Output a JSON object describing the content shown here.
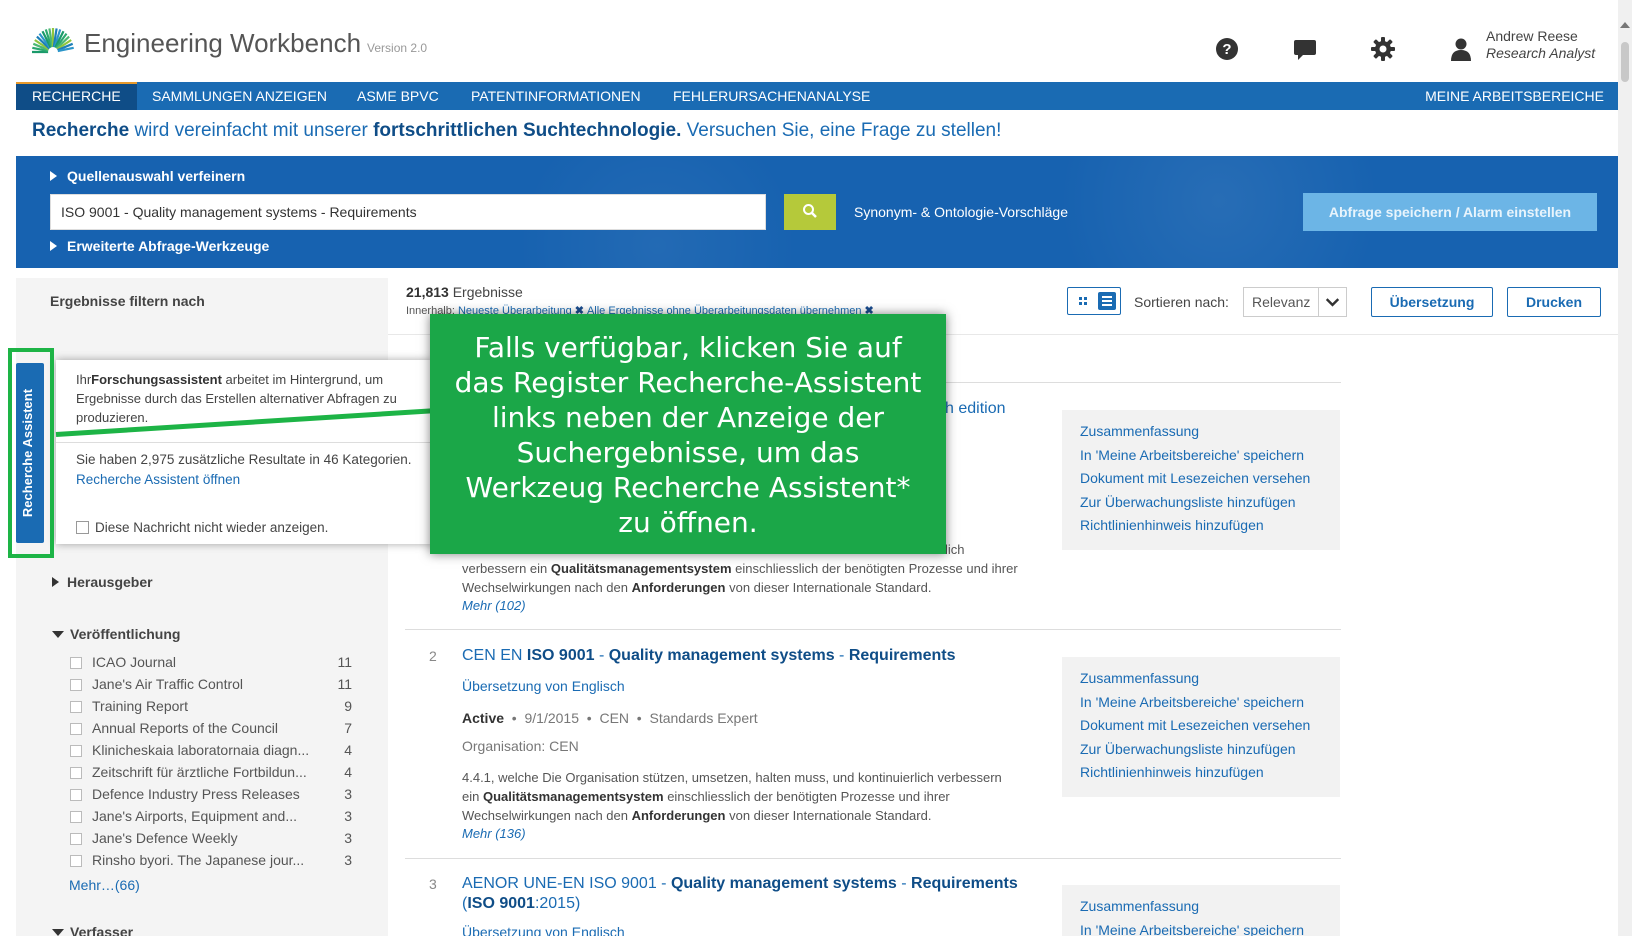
{
  "header": {
    "app_title": "Engineering Workbench",
    "version": "Version 2.0",
    "user_name": "Andrew Reese",
    "user_role": "Research Analyst"
  },
  "nav": {
    "items": [
      "RECHERCHE",
      "SAMMLUNGEN ANZEIGEN",
      "ASME BPVC",
      "PATENTINFORMATIONEN",
      "FEHLERURSACHENANALYSE"
    ],
    "active_index": 0,
    "right_item": "MEINE ARBEITSBEREICHE"
  },
  "tagline": {
    "part1": "Recherche",
    "part2": " wird vereinfacht mit unserer ",
    "part3": "fortschrittlichen Suchtechnologie.",
    "part4": " Versuchen Sie, eine Frage zu stellen!"
  },
  "search": {
    "refine_sources": "Quellenauswahl verfeinern",
    "query": "ISO 9001 - Quality management systems - Requirements",
    "synonyms": "Synonym- & Ontologie-Vorschläge",
    "advanced_tools": "Erweiterte Abfrage-Werkzeuge",
    "save_button": "Abfrage speichern / Alarm einstellen"
  },
  "results_header": {
    "filter_title": "Ergebnisse filtern nach",
    "count": "21,813",
    "count_label": " Ergebnisse",
    "within_label": "Innerhalb: ",
    "filter1": "Neueste Überarbeitung",
    "filter2": "Alle Ergebnisse ohne Überarbeitungsdaten übernehmen",
    "sort_label": "Sortieren nach:",
    "sort_value": "Relevanz",
    "translate_button": "Übersetzung",
    "print_button": "Drucken"
  },
  "results": [
    {
      "title_tail": "h edition",
      "snippet_a": "verbessern ein ",
      "snippet_b": "Qualitätsmanagementsystem",
      "snippet_c": " einschliesslich der benötigten Prozesse und ihrer Wechselwirkungen nach den ",
      "snippet_d": "Anforderungen",
      "snippet_e": " von dieser Internationale Standard.",
      "snippet_frag": "lich",
      "more": "Mehr (102)"
    },
    {
      "num": "2",
      "title_a": "CEN EN ",
      "title_b": "ISO 9001",
      "title_c": " - ",
      "title_d": "Quality management systems",
      "title_e": " - ",
      "title_f": "Requirements",
      "translated": "Übersetzung von Englisch",
      "status": "Active",
      "date": "9/1/2015",
      "publisher": "CEN",
      "source": "Standards Expert",
      "org": "Organisation: CEN",
      "snippet_a": "4.4.1, welche Die Organisation stützen, umsetzen, halten muss, und kontinuierlich verbessern ein ",
      "snippet_b": "Qualitätsmanagementsystem",
      "snippet_c": " einschliesslich der benötigten Prozesse und ihrer Wechselwirkungen nach den ",
      "snippet_d": "Anforderungen",
      "snippet_e": " von dieser Internationale Standard.",
      "more": "Mehr (136)"
    },
    {
      "num": "3",
      "title_a": "AENOR UNE-EN ISO 9001 - ",
      "title_b": "Quality management systems",
      "title_c": " - ",
      "title_d": "Requirements",
      "title_e": " (",
      "title_f": "ISO 9001",
      "title_g": ":2015)",
      "translated": "Übersetzung von Englisch"
    }
  ],
  "actions": [
    "Zusammenfassung",
    "In 'Meine Arbeitsbereiche' speichern",
    "Dokument mit Lesezeichen versehen",
    "Zur Überwachungsliste hinzufügen",
    "Richtlinienhinweis hinzufügen"
  ],
  "facets": {
    "publisher": "Herausgeber",
    "publication": "Veröffentlichung",
    "author": "Verfasser",
    "items": [
      {
        "label": "ICAO Journal",
        "count": "11"
      },
      {
        "label": "Jane's Air Traffic Control",
        "count": "11"
      },
      {
        "label": "Training Report",
        "count": "9"
      },
      {
        "label": "Annual Reports of the Council",
        "count": "7"
      },
      {
        "label": "Klinicheskaia laboratornaia diagn...",
        "count": "4"
      },
      {
        "label": "Zeitschrift für ärztliche Fortbildun...",
        "count": "4"
      },
      {
        "label": "Defence Industry Press Releases",
        "count": "3"
      },
      {
        "label": "Jane's Airports, Equipment and...",
        "count": "3"
      },
      {
        "label": "Jane's Defence Weekly",
        "count": "3"
      },
      {
        "label": "Rinsho byori. The Japanese jour...",
        "count": "3"
      }
    ],
    "more": "Mehr…(66)"
  },
  "assistant": {
    "tab_label": "Recherche Assistent",
    "p1_a": "Ihr",
    "p1_b": "Forschungsassistent",
    "p1_c": " arbeitet im Hintergrund, um Ergebnisse durch das Erstellen alternativer Abfragen zu produzieren.",
    "p2": "Sie haben 2,975 zusätzliche Resultate in 46 Kategorien.",
    "open_link": "Recherche Assistent öffnen",
    "dont_show": "Diese Nachricht nicht wieder anzeigen."
  },
  "callout": "Falls verfügbar, klicken Sie auf das Register Recherche-Assistent links neben der Anzeige der Suchergebnisse, um das Werkzeug Recherche Assistent* zu öffnen.",
  "colors": {
    "nav_blue": "#1a6bb3",
    "search_band": "#1762b0",
    "search_button": "#b5c93a",
    "callout_green": "#1ba748",
    "highlight_frame": "#1db446"
  }
}
